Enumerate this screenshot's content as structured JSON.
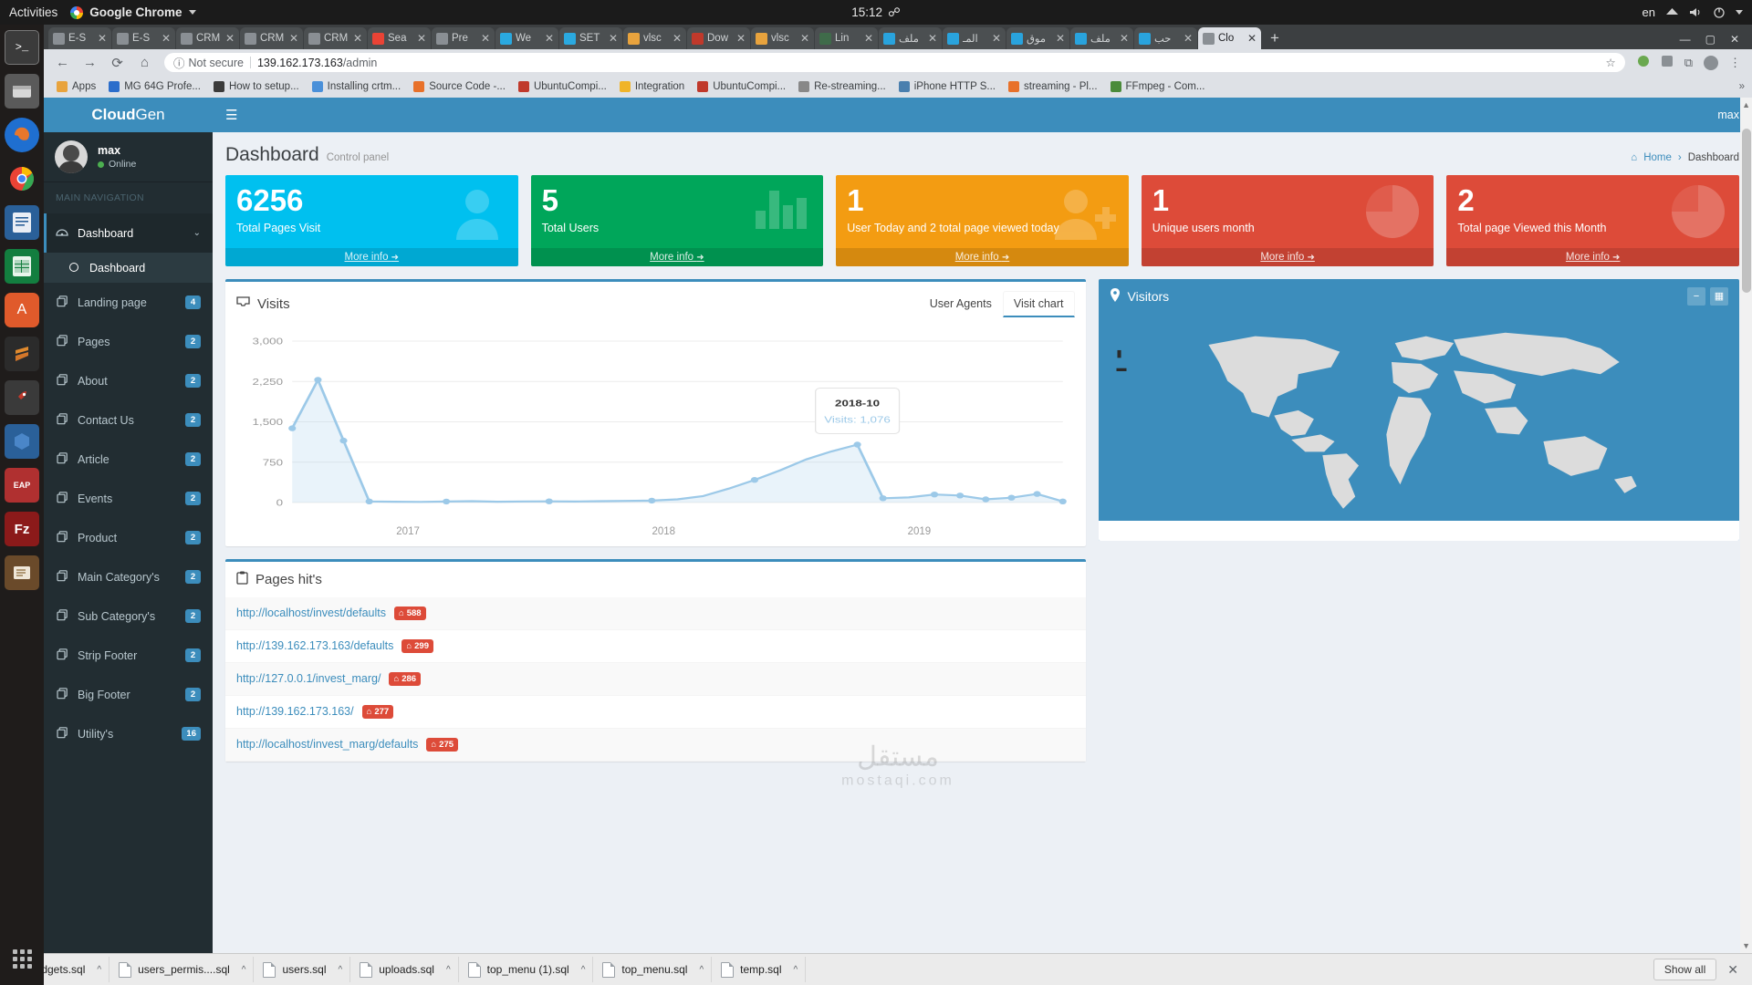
{
  "os": {
    "activities": "Activities",
    "app_name": "Google Chrome",
    "clock": "15:12",
    "keyboard": "en"
  },
  "browser": {
    "tabs": [
      {
        "label": "E-S",
        "fav": "globe",
        "active": false
      },
      {
        "label": "E-S",
        "fav": "globe",
        "active": false
      },
      {
        "label": "CRM",
        "fav": "globe",
        "active": false
      },
      {
        "label": "CRM",
        "fav": "globe",
        "active": false
      },
      {
        "label": "CRM",
        "fav": "globe",
        "active": false
      },
      {
        "label": "Sea",
        "fav": "gmail",
        "active": false
      },
      {
        "label": "Pre",
        "fav": "globe",
        "active": false
      },
      {
        "label": "We",
        "fav": "webmin",
        "active": false
      },
      {
        "label": "SET",
        "fav": "webmin",
        "active": false
      },
      {
        "label": "vlsc",
        "fav": "pma",
        "active": false
      },
      {
        "label": "Dow",
        "fav": "filezilla",
        "active": false
      },
      {
        "label": "vlsc",
        "fav": "pma",
        "active": false
      },
      {
        "label": "Lin",
        "fav": "linux",
        "active": false
      },
      {
        "label": "ملف",
        "fav": "blue-o",
        "active": false
      },
      {
        "label": "المـ",
        "fav": "blue-o",
        "active": false
      },
      {
        "label": "موق",
        "fav": "blue-o",
        "active": false
      },
      {
        "label": "ملف",
        "fav": "blue-o",
        "active": false
      },
      {
        "label": "حب",
        "fav": "blue-o",
        "active": false
      },
      {
        "label": "Clo",
        "fav": "globe",
        "active": true
      }
    ],
    "newtab_label": "+",
    "nav": {
      "back": "←",
      "forward": "→",
      "reload": "C",
      "home": "⌂"
    },
    "url": {
      "security": "Not secure",
      "host": "139.162.173.163",
      "path": "/admin"
    },
    "bookmarks": [
      {
        "label": "Apps",
        "color": "#e8a33d"
      },
      {
        "label": "MG 64G Profe...",
        "color": "#2c6ecb"
      },
      {
        "label": "How to setup...",
        "color": "#3b3b3b"
      },
      {
        "label": "Installing crtm...",
        "color": "#4a90d9"
      },
      {
        "label": "Source Code -...",
        "color": "#e8712a"
      },
      {
        "label": "UbuntuCompi...",
        "color": "#c0392b"
      },
      {
        "label": "Integration",
        "color": "#f0b429"
      },
      {
        "label": "UbuntuCompi...",
        "color": "#c0392b"
      },
      {
        "label": "Re-streaming...",
        "color": "#888888"
      },
      {
        "label": "iPhone HTTP S...",
        "color": "#4a7fae"
      },
      {
        "label": "streaming - Pl...",
        "color": "#e8712a"
      },
      {
        "label": "FFmpeg - Com...",
        "color": "#4b8b3b"
      }
    ],
    "bookmarks_overflow": "»"
  },
  "app": {
    "brand": {
      "bold": "Cloud",
      "light": "Gen"
    },
    "navbar_user": "max",
    "user": {
      "name": "max",
      "status": "Online"
    },
    "nav_header": "MAIN NAVIGATION",
    "nav_items": [
      {
        "label": "Dashboard",
        "icon": "dashboard-icon",
        "badge": "",
        "active": true,
        "expandable": true
      },
      {
        "label": "Dashboard",
        "icon": "circle-o-icon",
        "badge": "",
        "sub": true
      },
      {
        "label": "Landing page",
        "icon": "files-icon",
        "badge": "4"
      },
      {
        "label": "Pages",
        "icon": "files-icon",
        "badge": "2"
      },
      {
        "label": "About",
        "icon": "files-icon",
        "badge": "2"
      },
      {
        "label": "Contact Us",
        "icon": "files-icon",
        "badge": "2"
      },
      {
        "label": "Article",
        "icon": "files-icon",
        "badge": "2"
      },
      {
        "label": "Events",
        "icon": "files-icon",
        "badge": "2"
      },
      {
        "label": "Product",
        "icon": "files-icon",
        "badge": "2"
      },
      {
        "label": "Main Category's",
        "icon": "files-icon",
        "badge": "2"
      },
      {
        "label": "Sub Category's",
        "icon": "files-icon",
        "badge": "2"
      },
      {
        "label": "Strip Footer",
        "icon": "files-icon",
        "badge": "2"
      },
      {
        "label": "Big Footer",
        "icon": "files-icon",
        "badge": "2"
      },
      {
        "label": "Utility's",
        "icon": "files-icon",
        "badge": "16"
      }
    ],
    "page_title": "Dashboard",
    "page_subtitle": "Control panel",
    "breadcrumb": {
      "home": "Home",
      "sep": "›",
      "current": "Dashboard"
    },
    "stat_boxes": [
      {
        "number": "6256",
        "text": "Total Pages Visit",
        "more": "More info",
        "color": "#00c0ef",
        "icon": "user-icon"
      },
      {
        "number": "5",
        "text": "Total Users",
        "more": "More info",
        "color": "#00a65a",
        "icon": "bar-chart-icon"
      },
      {
        "number": "1",
        "text": "User Today and 2 total page viewed today",
        "more": "More info",
        "color": "#f39c12",
        "icon": "user-plus-icon"
      },
      {
        "number": "1",
        "text": "Unique users month",
        "more": "More info",
        "color": "#dd4b39",
        "icon": "pie-chart-icon"
      },
      {
        "number": "2",
        "text": "Total page Viewed this Month",
        "more": "More info",
        "color": "#dd4b39",
        "icon": "pie-chart-icon"
      }
    ],
    "visits_box": {
      "title": "Visits",
      "icon": "inbox-icon",
      "tabs": [
        {
          "label": "User Agents",
          "active": false
        },
        {
          "label": "Visit chart",
          "active": true
        }
      ]
    },
    "visitors_box": {
      "title": "Visitors",
      "icon": "map-marker-icon",
      "tools": [
        {
          "name": "minus-icon",
          "glyph": "−"
        },
        {
          "name": "calendar-icon",
          "glyph": "▦"
        }
      ]
    },
    "pages_hit": {
      "title": "Pages hit's",
      "icon": "clipboard-icon",
      "rows": [
        {
          "url": "http://localhost/invest/defaults",
          "count": "588"
        },
        {
          "url": "http://139.162.173.163/defaults",
          "count": "299"
        },
        {
          "url": "http://127.0.0.1/invest_marg/",
          "count": "286"
        },
        {
          "url": "http://139.162.173.163/",
          "count": "277"
        },
        {
          "url": "http://localhost/invest_marg/defaults",
          "count": "275"
        }
      ]
    },
    "watermark": {
      "ar": "مستقل",
      "en": "mostaqi.com"
    }
  },
  "chart_data": {
    "type": "area",
    "title": "Visits",
    "xlabel": "",
    "ylabel": "",
    "ylim": [
      0,
      3000
    ],
    "yticks": [
      0,
      750,
      1500,
      2250,
      3000
    ],
    "ytick_labels": [
      "0",
      "750",
      "1,500",
      "2,250",
      "3,000"
    ],
    "grid": true,
    "xtick_labels": [
      "2017",
      "2018",
      "2019"
    ],
    "xtick_positions": [
      1,
      8,
      16
    ],
    "series": [
      {
        "name": "Visits",
        "color": "#9cc9e8",
        "x": [
          "2016-12",
          "2017-01",
          "2017-02",
          "2017-03",
          "2017-04",
          "2017-05",
          "2017-06",
          "2017-07",
          "2017-08",
          "2017-09",
          "2017-10",
          "2017-11",
          "2017-12",
          "2018-01",
          "2018-02",
          "2018-03",
          "2018-04",
          "2018-05",
          "2018-06",
          "2018-07",
          "2018-08",
          "2018-09",
          "2018-10",
          "2018-11",
          "2018-12",
          "2019-01",
          "2019-02",
          "2019-03",
          "2019-04",
          "2019-05",
          "2019-06"
        ],
        "values": [
          1380,
          2280,
          1150,
          20,
          15,
          12,
          18,
          25,
          15,
          20,
          22,
          18,
          25,
          30,
          35,
          60,
          120,
          260,
          420,
          600,
          800,
          950,
          1076,
          80,
          95,
          150,
          130,
          60,
          90,
          160,
          20
        ]
      }
    ],
    "tooltip": {
      "label": "2018-10",
      "value_label": "Visits: 1,076"
    }
  },
  "downloads": {
    "items": [
      {
        "name": "widgets.sql",
        "caret": "^"
      },
      {
        "name": "users_permis....sql",
        "caret": "^"
      },
      {
        "name": "users.sql",
        "caret": "^"
      },
      {
        "name": "uploads.sql",
        "caret": "^"
      },
      {
        "name": "top_menu (1).sql",
        "caret": "^"
      },
      {
        "name": "top_menu.sql",
        "caret": "^"
      },
      {
        "name": "temp.sql",
        "caret": "^"
      }
    ],
    "show_all": "Show all",
    "close": "✕"
  }
}
